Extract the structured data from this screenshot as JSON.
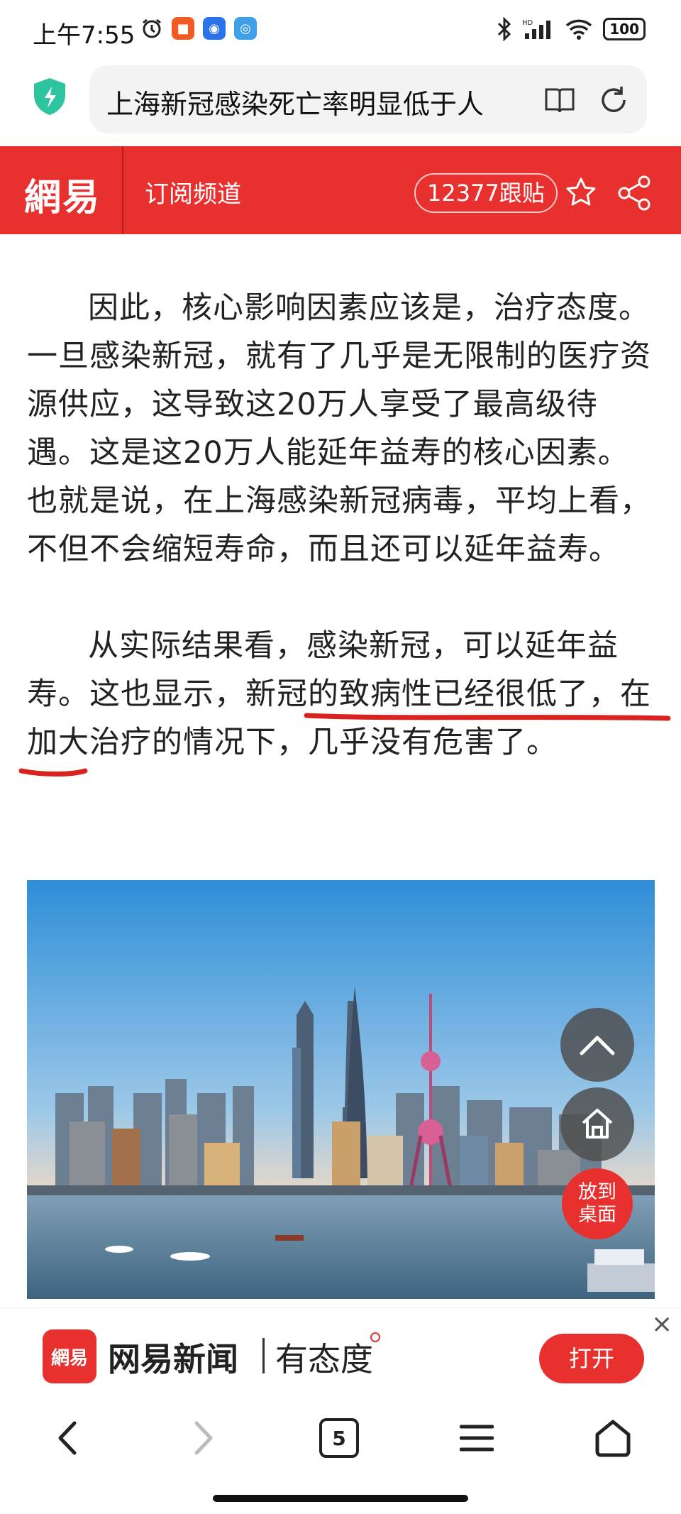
{
  "status_bar": {
    "time": "上午7:55",
    "battery": "100"
  },
  "browser": {
    "url_title": "上海新冠感染死亡率明显低于人"
  },
  "header": {
    "logo": "網易",
    "channel": "订阅频道",
    "follow_count": "12377跟贴"
  },
  "article": {
    "paragraphs": [
      "因此，核心影响因素应该是，治疗态度。一旦感染新冠，就有了几乎是无限制的医疗资源供应，这导致这20万人享受了最高级待遇。这是这20万人能延年益寿的核心因素。也就是说，在上海感染新冠病毒，平均上看，不但不会缩短寿命，而且还可以延年益寿。",
      "从实际结果看，感染新冠，可以延年益寿。这也显示，新冠的致病性已经很低了，在加大治疗的情况下，几乎没有危害了。"
    ]
  },
  "floating": {
    "desktop_line1": "放到",
    "desktop_line2": "桌面"
  },
  "promo": {
    "logo": "網易",
    "app_name": "网易新闻",
    "slogan": "有态度",
    "open_label": "打开",
    "close_label": "×"
  },
  "toolbar": {
    "tab_count": "5"
  },
  "colors": {
    "brand_red": "#e8302f",
    "underline_red": "#d8231f"
  }
}
